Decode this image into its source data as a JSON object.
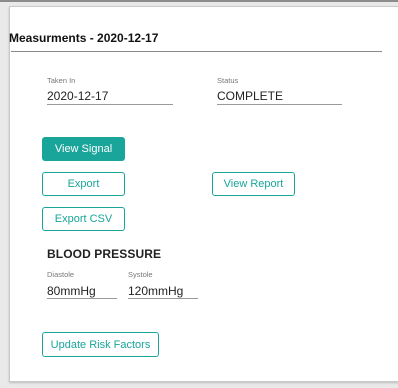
{
  "card": {
    "title": "Measurments - 2020-12-17"
  },
  "fields": {
    "taken_in": {
      "label": "Taken In",
      "value": "2020-12-17"
    },
    "status": {
      "label": "Status",
      "value": "COMPLETE"
    }
  },
  "buttons": {
    "view_signal": "View Signal",
    "export": "Export",
    "view_report": "View Report",
    "export_csv": "Export CSV",
    "update_risk_factors": "Update Risk Factors"
  },
  "blood_pressure": {
    "heading": "BLOOD PRESSURE",
    "diastole": {
      "label": "Diastole",
      "value": "80mmHg"
    },
    "systole": {
      "label": "Systole",
      "value": "120mmHg"
    }
  },
  "colors": {
    "accent": "#19a59a",
    "page_background": "#e9e9e9",
    "card_background": "#ffffff"
  }
}
